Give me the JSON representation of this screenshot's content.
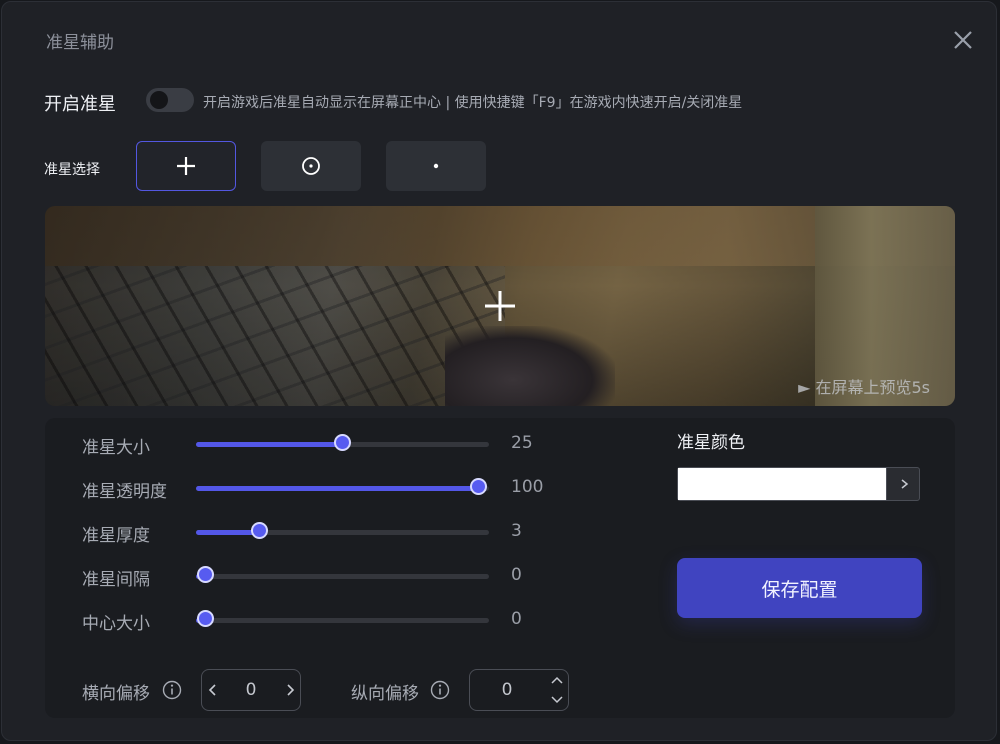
{
  "window": {
    "title": "准星辅助"
  },
  "enable": {
    "label": "开启准星",
    "hint": "开启游戏后准星自动显示在屏幕正中心 | 使用快捷键「F9」在游戏内快速开启/关闭准星",
    "on": false
  },
  "crosshair_select": {
    "label": "准星选择",
    "options": [
      "plus-icon",
      "circle-dot-icon",
      "dot-icon"
    ],
    "selected_index": 0
  },
  "preview": {
    "hint": "► 在屏幕上预览5s"
  },
  "sliders": [
    {
      "label": "准星大小",
      "value": "25",
      "fraction": 0.5
    },
    {
      "label": "准星透明度",
      "value": "100",
      "fraction": 0.965
    },
    {
      "label": "准星厚度",
      "value": "3",
      "fraction": 0.22
    },
    {
      "label": "准星间隔",
      "value": "0",
      "fraction": 0.035
    },
    {
      "label": "中心大小",
      "value": "0",
      "fraction": 0.035
    }
  ],
  "color": {
    "label": "准星颜色",
    "value": "#ffffff"
  },
  "save": {
    "label": "保存配置"
  },
  "offset": {
    "horizontal_label": "横向偏移",
    "horizontal_value": "0",
    "vertical_label": "纵向偏移",
    "vertical_value": "0"
  },
  "colors": {
    "accent": "#5357e8",
    "button": "#4044c0"
  }
}
